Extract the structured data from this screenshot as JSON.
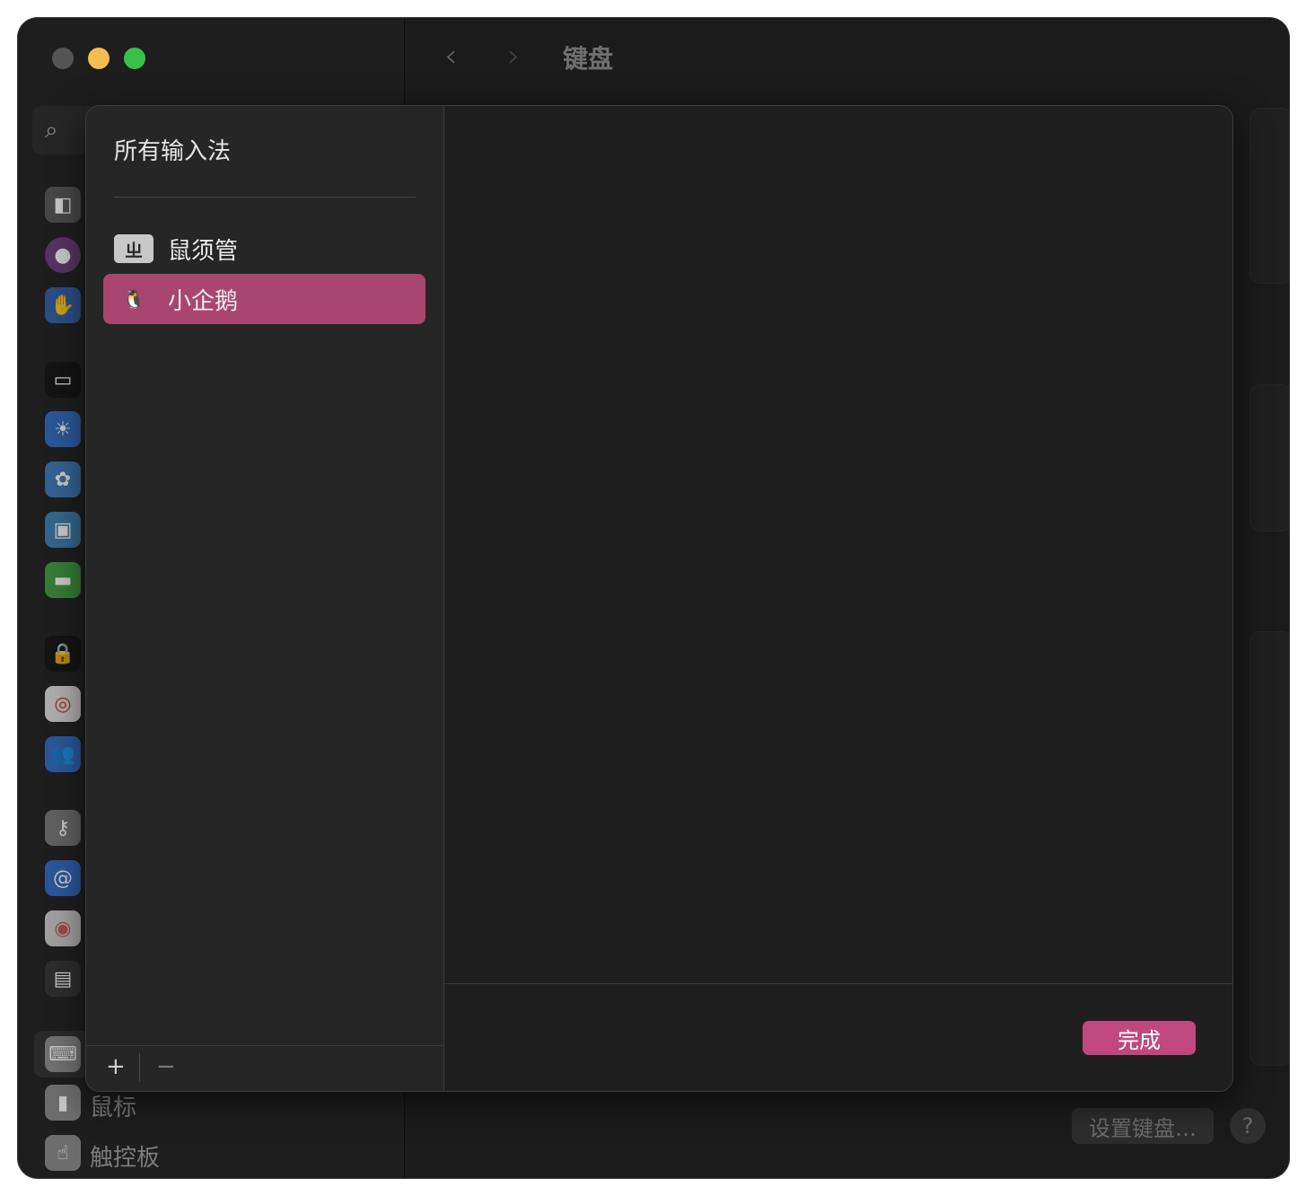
{
  "window": {
    "title": "键盘"
  },
  "sidebar": {
    "search_icon": "search-icon",
    "visible_labels": [
      "鼠标",
      "触控板"
    ]
  },
  "main": {
    "setup_button": "设置键盘…",
    "help_button": "?"
  },
  "sheet": {
    "list_title": "所有输入法",
    "input_methods": [
      {
        "label": "鼠须管",
        "icon": "ㄓ",
        "selected": false
      },
      {
        "label": "小企鹅",
        "icon": "🐧",
        "selected": true
      }
    ],
    "add_label": "+",
    "remove_label": "−",
    "done_button": "完成"
  },
  "colors": {
    "accent": "#c1487d",
    "selected_row": "#a84670",
    "window_bg": "#1d1d1d"
  }
}
